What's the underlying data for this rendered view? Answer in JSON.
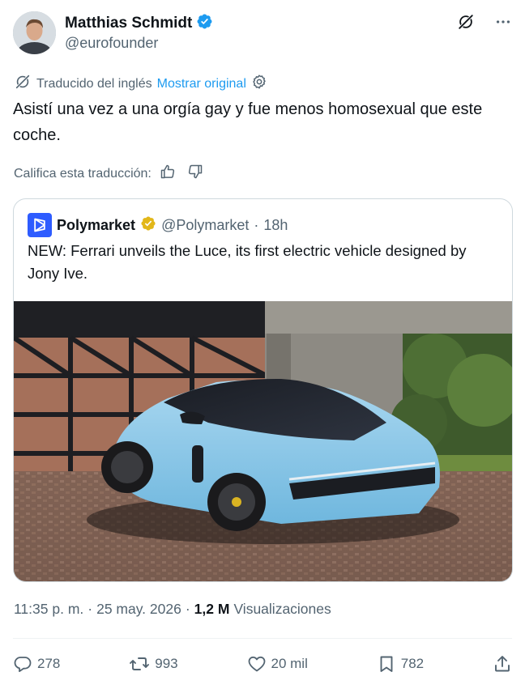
{
  "author": {
    "display_name": "Matthias Schmidt",
    "handle": "@eurofounder",
    "verified_icon": "verified-badge-icon",
    "verified_color": "#1d9bf0"
  },
  "top_icons": [
    "grok-icon",
    "more-icon"
  ],
  "translation": {
    "label": "Traducido del inglés",
    "show_original": "Mostrar original",
    "icon": "translate-icon",
    "settings_icon": "gear-icon"
  },
  "tweet": {
    "text": "Asistí una vez a una orgía gay y fue menos homosexual que este coche."
  },
  "rate_translation": {
    "label": "Califica esta traducción:",
    "icons": [
      "thumbs-up-icon",
      "thumbs-down-icon"
    ]
  },
  "quote": {
    "name": "Polymarket",
    "handle": "@Polymarket",
    "separator": "·",
    "time": "18h",
    "text": "NEW: Ferrari unveils the Luce, its first electric vehicle designed by Jony Ive.",
    "badge_color": "#e2b719",
    "logo_color": "#2e5cff"
  },
  "meta": {
    "time": "11:35 p. m.",
    "sep1": "·",
    "date": "25 may. 2026",
    "sep2": "·",
    "views_count": "1,2 M",
    "views_label": "Visualizaciones"
  },
  "actions": {
    "replies": "278",
    "reposts": "993",
    "likes": "20 mil",
    "bookmarks": "782"
  },
  "colors": {
    "text_primary": "#0f1419",
    "text_secondary": "#536471",
    "link": "#1d9bf0",
    "border": "#cfd9de"
  }
}
